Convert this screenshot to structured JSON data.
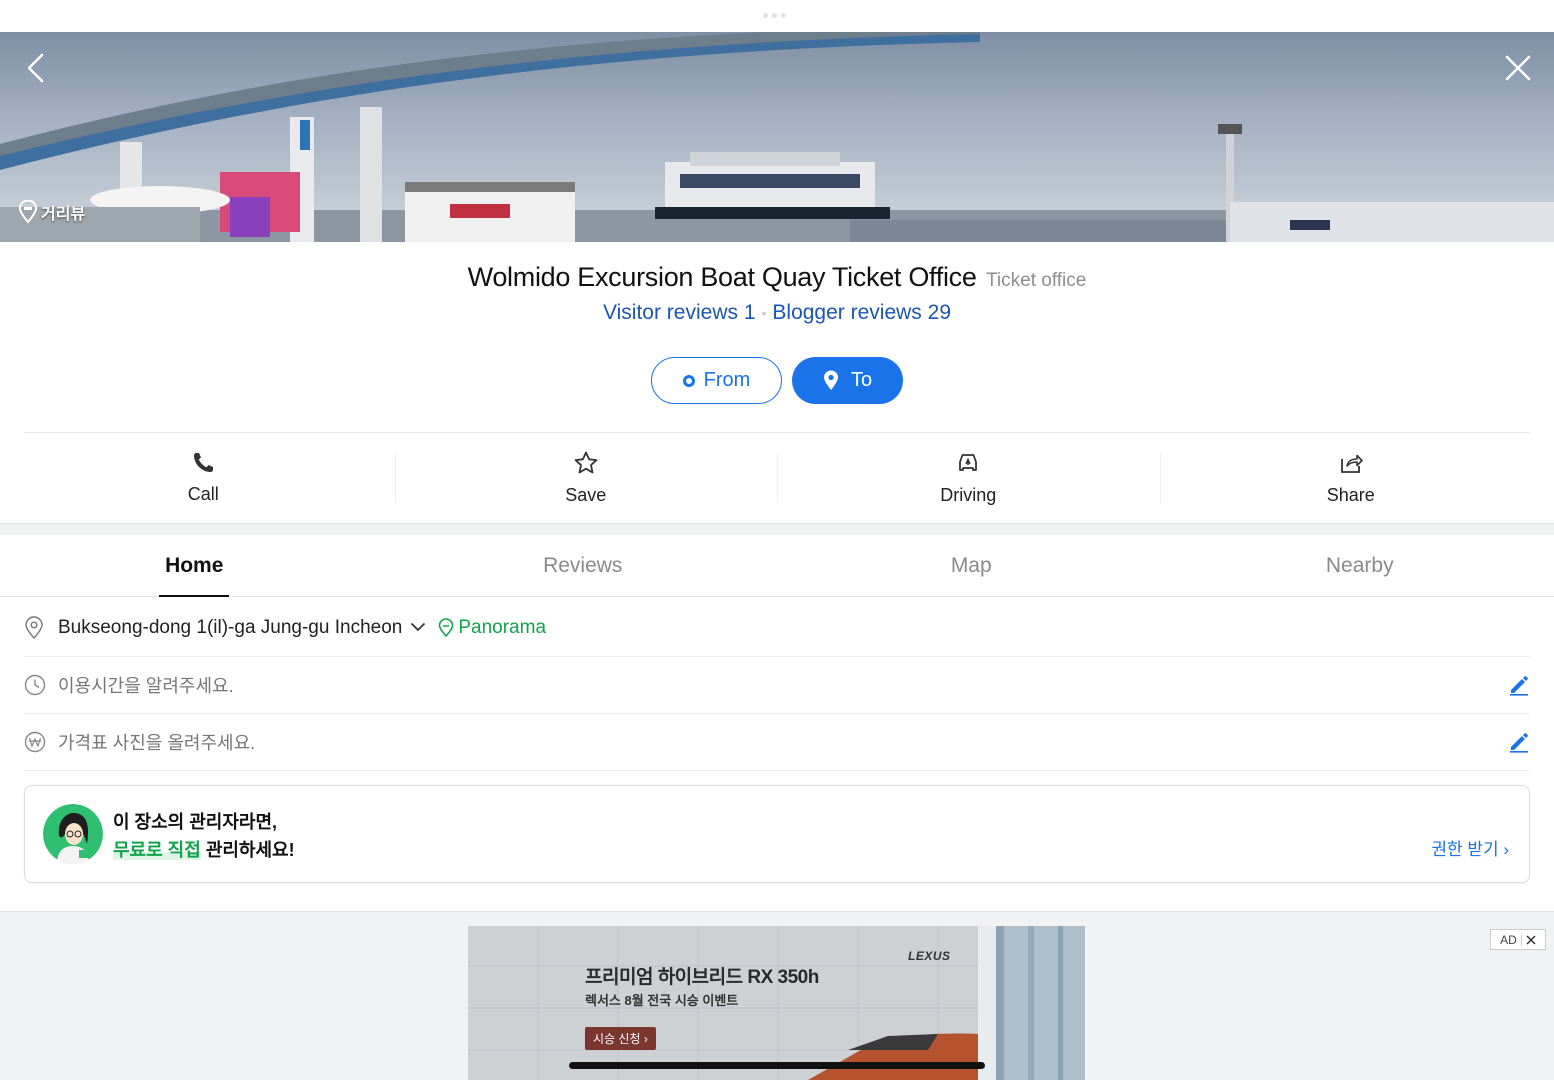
{
  "hero": {
    "streetview_label": "거리뷰"
  },
  "place": {
    "name": "Wolmido Excursion Boat Quay Ticket Office",
    "category": "Ticket office",
    "visitor_reviews": "Visitor reviews 1",
    "blogger_reviews": "Blogger reviews 29"
  },
  "route": {
    "from_label": "From",
    "to_label": "To"
  },
  "actions": [
    {
      "label": "Call",
      "icon": "phone-icon"
    },
    {
      "label": "Save",
      "icon": "star-icon"
    },
    {
      "label": "Driving",
      "icon": "car-icon"
    },
    {
      "label": "Share",
      "icon": "share-icon"
    }
  ],
  "tabs": [
    "Home",
    "Reviews",
    "Map",
    "Nearby"
  ],
  "active_tab": "Home",
  "info": {
    "address": "Bukseong-dong 1(il)-ga Jung-gu Incheon",
    "panorama_label": "Panorama",
    "hours_placeholder": "이용시간을 알려주세요.",
    "price_placeholder": "가격표 사진을 올려주세요."
  },
  "owner_card": {
    "line1": "이 장소의 관리자라면,",
    "line2_highlight": "무료로 직접",
    "line2_rest": " 관리하세요!",
    "link_label": "권한 받기 ›"
  },
  "ad": {
    "headline": "프리미엄 하이브리드 RX 350h",
    "subline": "렉서스 8월 전국 시승 이벤트",
    "brand": "LEXUS",
    "cta": "시승 신청 ›",
    "badge": "AD"
  },
  "colors": {
    "accent_blue": "#1a73e8",
    "link_blue": "#1a56b5",
    "green": "#10a34a"
  }
}
